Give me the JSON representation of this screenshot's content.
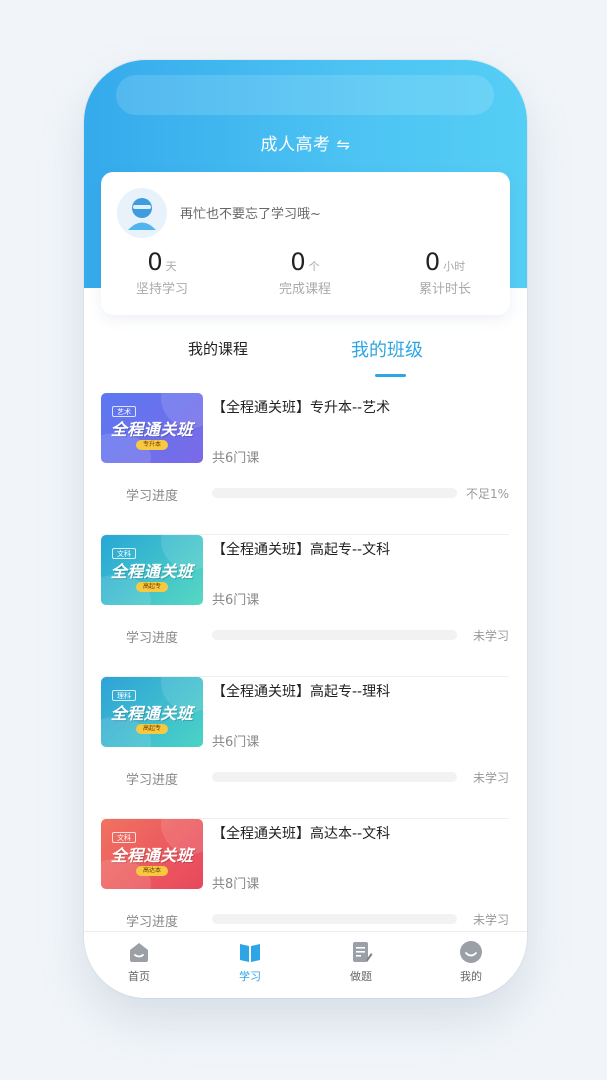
{
  "app": {
    "title": "成人高考",
    "switch_symbol": "⇋"
  },
  "profile": {
    "greeting": "再忙也不要忘了学习哦~",
    "stats": [
      {
        "value": "0",
        "unit": "天",
        "label": "坚持学习"
      },
      {
        "value": "0",
        "unit": "个",
        "label": "完成课程"
      },
      {
        "value": "0",
        "unit": "小时",
        "label": "累计时长"
      }
    ]
  },
  "tabs": [
    {
      "label": "我的课程",
      "active": false
    },
    {
      "label": "我的班级",
      "active": true
    }
  ],
  "progress_label": "学习进度",
  "courses": [
    {
      "title": "【全程通关班】专升本--艺术",
      "lesson_count": "共6门课",
      "progress_fraction": 0.0,
      "progress_status": "不足1%",
      "thumb": {
        "tag": "艺术",
        "big_text": "全程通关班",
        "pill": "专升本",
        "gradient": [
          "#5b78f1",
          "#7b6ae8"
        ]
      }
    },
    {
      "title": "【全程通关班】高起专--文科",
      "lesson_count": "共6门课",
      "progress_fraction": 0.0,
      "progress_status": "未学习",
      "thumb": {
        "tag": "文科",
        "big_text": "全程通关班",
        "pill": "高起专",
        "gradient": [
          "#27a6d6",
          "#57d8c2"
        ]
      }
    },
    {
      "title": "【全程通关班】高起专--理科",
      "lesson_count": "共6门课",
      "progress_fraction": 0.0,
      "progress_status": "未学习",
      "thumb": {
        "tag": "理科",
        "big_text": "全程通关班",
        "pill": "高起专",
        "gradient": [
          "#2ea2d8",
          "#4bd3c6"
        ]
      }
    },
    {
      "title": "【全程通关班】高达本--文科",
      "lesson_count": "共8门课",
      "progress_fraction": 0.0,
      "progress_status": "未学习",
      "thumb": {
        "tag": "文科",
        "big_text": "全程通关班",
        "pill": "高达本",
        "gradient": [
          "#f07261",
          "#e8475d"
        ]
      }
    }
  ],
  "bottom_nav": [
    {
      "label": "首页",
      "icon": "home-icon",
      "active": false
    },
    {
      "label": "学习",
      "icon": "book-icon",
      "active": true
    },
    {
      "label": "做题",
      "icon": "exercise-icon",
      "active": false
    },
    {
      "label": "我的",
      "icon": "profile-icon",
      "active": false
    }
  ],
  "colors": {
    "accent": "#2ea5e6",
    "header_start": "#35aaec",
    "header_end": "#55cef5"
  }
}
